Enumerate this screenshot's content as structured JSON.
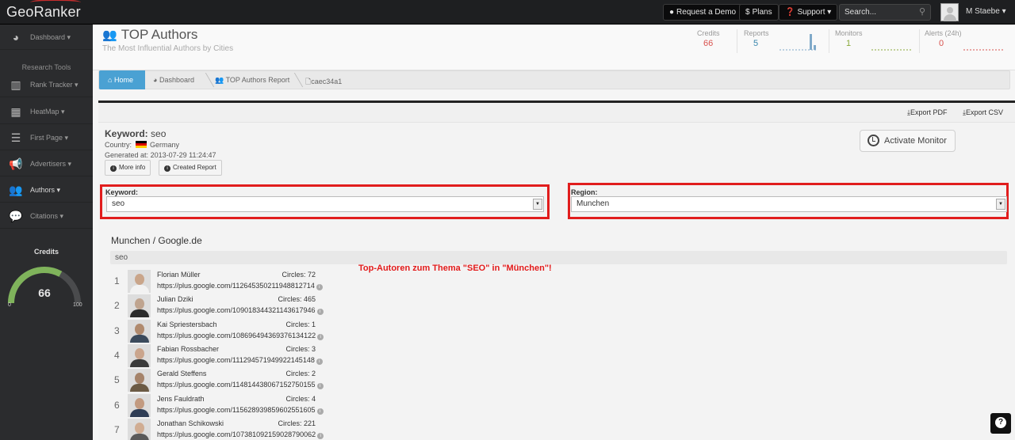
{
  "app": {
    "logo": "GeoRanker"
  },
  "topbar": {
    "request_demo": "Request a Demo",
    "plans": "Plans",
    "support": "Support",
    "search_placeholder": "Search...",
    "user": "M Staebe"
  },
  "sidebar": {
    "dashboard": "Dashboard",
    "research_tools": "Research Tools",
    "rank_tracker": "Rank Tracker",
    "heatmap": "HeatMap",
    "first_page": "First Page",
    "advertisers": "Advertisers",
    "authors": "Authors",
    "citations": "Citations",
    "credits_title": "Credits",
    "credits_value": "66",
    "credits_min": "0",
    "credits_max": "100",
    "credits_fraction": 0.66
  },
  "header": {
    "title": "TOP Authors",
    "subtitle": "The Most Influential Authors by Cities",
    "stats": {
      "credits_label": "Credits",
      "credits_value": "66",
      "reports_label": "Reports",
      "reports_value": "5",
      "monitors_label": "Monitors",
      "monitors_value": "1",
      "alerts_label": "Alerts (24h)",
      "alerts_value": "0"
    }
  },
  "breadcrumb": {
    "home": "Home",
    "dashboard": "Dashboard",
    "report": "TOP Authors Report",
    "id": "caec34a1"
  },
  "toolbar": {
    "export_pdf": "Export PDF",
    "export_csv": "Export CSV"
  },
  "report": {
    "keyword_label": "Keyword:",
    "keyword_value": "seo",
    "country_label": "Country:",
    "country_value": "Germany",
    "generated_label": "Generated at:",
    "generated_value": "2013-07-29 11:24:47",
    "more_info": "More info",
    "created_report": "Created Report",
    "activate_monitor": "Activate Monitor"
  },
  "filters": {
    "keyword_label": "Keyword:",
    "keyword_value": "seo",
    "region_label": "Region:",
    "region_value": "Munchen"
  },
  "results": {
    "location": "Munchen / Google.de",
    "keyword_bar": "seo",
    "annotation": "Top-Autoren zum Thema \"SEO\" in \"München\"!",
    "authors": [
      {
        "rank": "1",
        "name": "Florian Müller",
        "circles": "Circles: 72",
        "url": "https://plus.google.com/112645350211948812714"
      },
      {
        "rank": "2",
        "name": "Julian Dziki",
        "circles": "Circles: 465",
        "url": "https://plus.google.com/109018344321143617946"
      },
      {
        "rank": "3",
        "name": "Kai Spriestersbach",
        "circles": "Circles: 1",
        "url": "https://plus.google.com/108696494369376134122"
      },
      {
        "rank": "4",
        "name": "Fabian Rossbacher",
        "circles": "Circles: 3",
        "url": "https://plus.google.com/111294571949922145148"
      },
      {
        "rank": "5",
        "name": "Gerald Steffens",
        "circles": "Circles: 2",
        "url": "https://plus.google.com/114814438067152750155"
      },
      {
        "rank": "6",
        "name": "Jens Fauldrath",
        "circles": "Circles: 4",
        "url": "https://plus.google.com/115628939859602551605"
      },
      {
        "rank": "7",
        "name": "Jonathan Schikowski",
        "circles": "Circles: 221",
        "url": "https://plus.google.com/107381092159028790062"
      }
    ]
  },
  "colors": {
    "accent": "#4aa1d3",
    "highlight": "#e11d1d",
    "gauge": "#7fb35b"
  }
}
